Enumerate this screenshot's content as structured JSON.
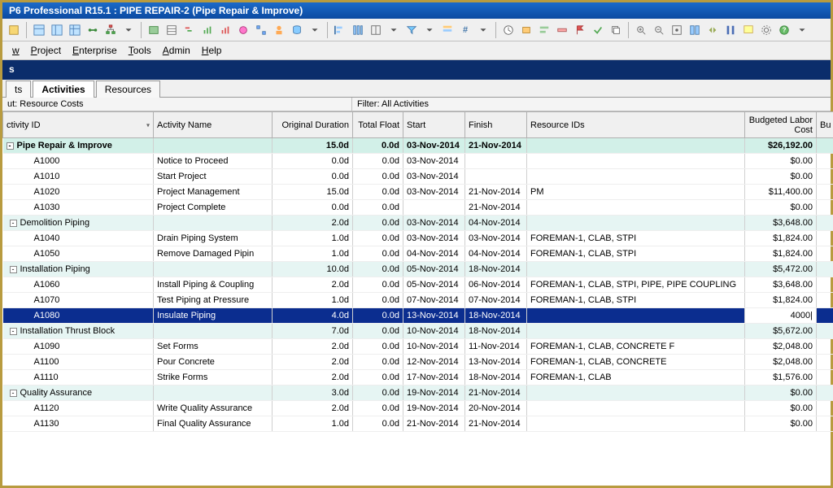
{
  "app": {
    "title": "P6 Professional R15.1 : PIPE REPAIR-2 (Pipe Repair & Improve)"
  },
  "menu": [
    "w",
    "Project",
    "Enterprise",
    "Tools",
    "Admin",
    "Help"
  ],
  "blue": "s",
  "tabs": [
    "ts",
    "Activities",
    "Resources"
  ],
  "layoutLabel": "ut: Resource Costs",
  "filterLabel": "Filter: All Activities",
  "columns": [
    "ctivity ID",
    "Activity Name",
    "Original Duration",
    "Total Float",
    "Start",
    "Finish",
    "Resource IDs",
    "Budgeted Labor Cost",
    "Bu"
  ],
  "editVal": "4000",
  "rows": [
    {
      "t": "group-top",
      "id": "Pipe Repair & Improve",
      "name": "",
      "dur": "15.0d",
      "float": "0.0d",
      "start": "03-Nov-2014",
      "finish": "21-Nov-2014",
      "res": "",
      "cost": "$26,192.00",
      "lvl": 0,
      "exp": "-"
    },
    {
      "t": "",
      "id": "A1000",
      "name": "Notice to Proceed",
      "dur": "0.0d",
      "float": "0.0d",
      "start": "03-Nov-2014",
      "finish": "",
      "res": "",
      "cost": "$0.00",
      "lvl": 2
    },
    {
      "t": "",
      "id": "A1010",
      "name": "Start Project",
      "dur": "0.0d",
      "float": "0.0d",
      "start": "03-Nov-2014",
      "finish": "",
      "res": "",
      "cost": "$0.00",
      "lvl": 2
    },
    {
      "t": "",
      "id": "A1020",
      "name": "Project Management",
      "dur": "15.0d",
      "float": "0.0d",
      "start": "03-Nov-2014",
      "finish": "21-Nov-2014",
      "res": "PM",
      "cost": "$11,400.00",
      "lvl": 2
    },
    {
      "t": "",
      "id": "A1030",
      "name": "Project Complete",
      "dur": "0.0d",
      "float": "0.0d",
      "start": "",
      "finish": "21-Nov-2014",
      "res": "",
      "cost": "$0.00",
      "lvl": 2
    },
    {
      "t": "group",
      "id": "Demolition Piping",
      "name": "",
      "dur": "2.0d",
      "float": "0.0d",
      "start": "03-Nov-2014",
      "finish": "04-Nov-2014",
      "res": "",
      "cost": "$3,648.00",
      "lvl": 1,
      "exp": "-"
    },
    {
      "t": "",
      "id": "A1040",
      "name": "Drain Piping System",
      "dur": "1.0d",
      "float": "0.0d",
      "start": "03-Nov-2014",
      "finish": "03-Nov-2014",
      "res": "FOREMAN-1, CLAB, STPI",
      "cost": "$1,824.00",
      "lvl": 2
    },
    {
      "t": "",
      "id": "A1050",
      "name": "Remove Damaged Pipin",
      "dur": "1.0d",
      "float": "0.0d",
      "start": "04-Nov-2014",
      "finish": "04-Nov-2014",
      "res": "FOREMAN-1, CLAB, STPI",
      "cost": "$1,824.00",
      "lvl": 2
    },
    {
      "t": "group",
      "id": "Installation Piping",
      "name": "",
      "dur": "10.0d",
      "float": "0.0d",
      "start": "05-Nov-2014",
      "finish": "18-Nov-2014",
      "res": "",
      "cost": "$5,472.00",
      "lvl": 1,
      "exp": "-"
    },
    {
      "t": "",
      "id": "A1060",
      "name": "Install Piping & Coupling",
      "dur": "2.0d",
      "float": "0.0d",
      "start": "05-Nov-2014",
      "finish": "06-Nov-2014",
      "res": "FOREMAN-1, CLAB, STPI, PIPE, PIPE COUPLING",
      "cost": "$3,648.00",
      "lvl": 2
    },
    {
      "t": "",
      "id": "A1070",
      "name": "Test Piping at Pressure",
      "dur": "1.0d",
      "float": "0.0d",
      "start": "07-Nov-2014",
      "finish": "07-Nov-2014",
      "res": "FOREMAN-1, CLAB, STPI",
      "cost": "$1,824.00",
      "lvl": 2
    },
    {
      "t": "sel",
      "id": "A1080",
      "name": "Insulate Piping",
      "dur": "4.0d",
      "float": "0.0d",
      "start": "13-Nov-2014",
      "finish": "18-Nov-2014",
      "res": "",
      "cost": "",
      "lvl": 2,
      "edit": true
    },
    {
      "t": "group",
      "id": "Installation Thrust Block",
      "name": "",
      "dur": "7.0d",
      "float": "0.0d",
      "start": "10-Nov-2014",
      "finish": "18-Nov-2014",
      "res": "",
      "cost": "$5,672.00",
      "lvl": 1,
      "exp": "-"
    },
    {
      "t": "",
      "id": "A1090",
      "name": "Set Forms",
      "dur": "2.0d",
      "float": "0.0d",
      "start": "10-Nov-2014",
      "finish": "11-Nov-2014",
      "res": "FOREMAN-1, CLAB, CONCRETE F",
      "cost": "$2,048.00",
      "lvl": 2
    },
    {
      "t": "",
      "id": "A1100",
      "name": "Pour Concrete",
      "dur": "2.0d",
      "float": "0.0d",
      "start": "12-Nov-2014",
      "finish": "13-Nov-2014",
      "res": "FOREMAN-1, CLAB, CONCRETE",
      "cost": "$2,048.00",
      "lvl": 2
    },
    {
      "t": "",
      "id": "A1110",
      "name": "Strike Forms",
      "dur": "2.0d",
      "float": "0.0d",
      "start": "17-Nov-2014",
      "finish": "18-Nov-2014",
      "res": "FOREMAN-1, CLAB",
      "cost": "$1,576.00",
      "lvl": 2
    },
    {
      "t": "group",
      "id": "Quality Assurance",
      "name": "",
      "dur": "3.0d",
      "float": "0.0d",
      "start": "19-Nov-2014",
      "finish": "21-Nov-2014",
      "res": "",
      "cost": "$0.00",
      "lvl": 1,
      "exp": "-"
    },
    {
      "t": "",
      "id": "A1120",
      "name": "Write Quality Assurance",
      "dur": "2.0d",
      "float": "0.0d",
      "start": "19-Nov-2014",
      "finish": "20-Nov-2014",
      "res": "",
      "cost": "$0.00",
      "lvl": 2
    },
    {
      "t": "",
      "id": "A1130",
      "name": "Final Quality Assurance",
      "dur": "1.0d",
      "float": "0.0d",
      "start": "21-Nov-2014",
      "finish": "21-Nov-2014",
      "res": "",
      "cost": "$0.00",
      "lvl": 2
    }
  ]
}
